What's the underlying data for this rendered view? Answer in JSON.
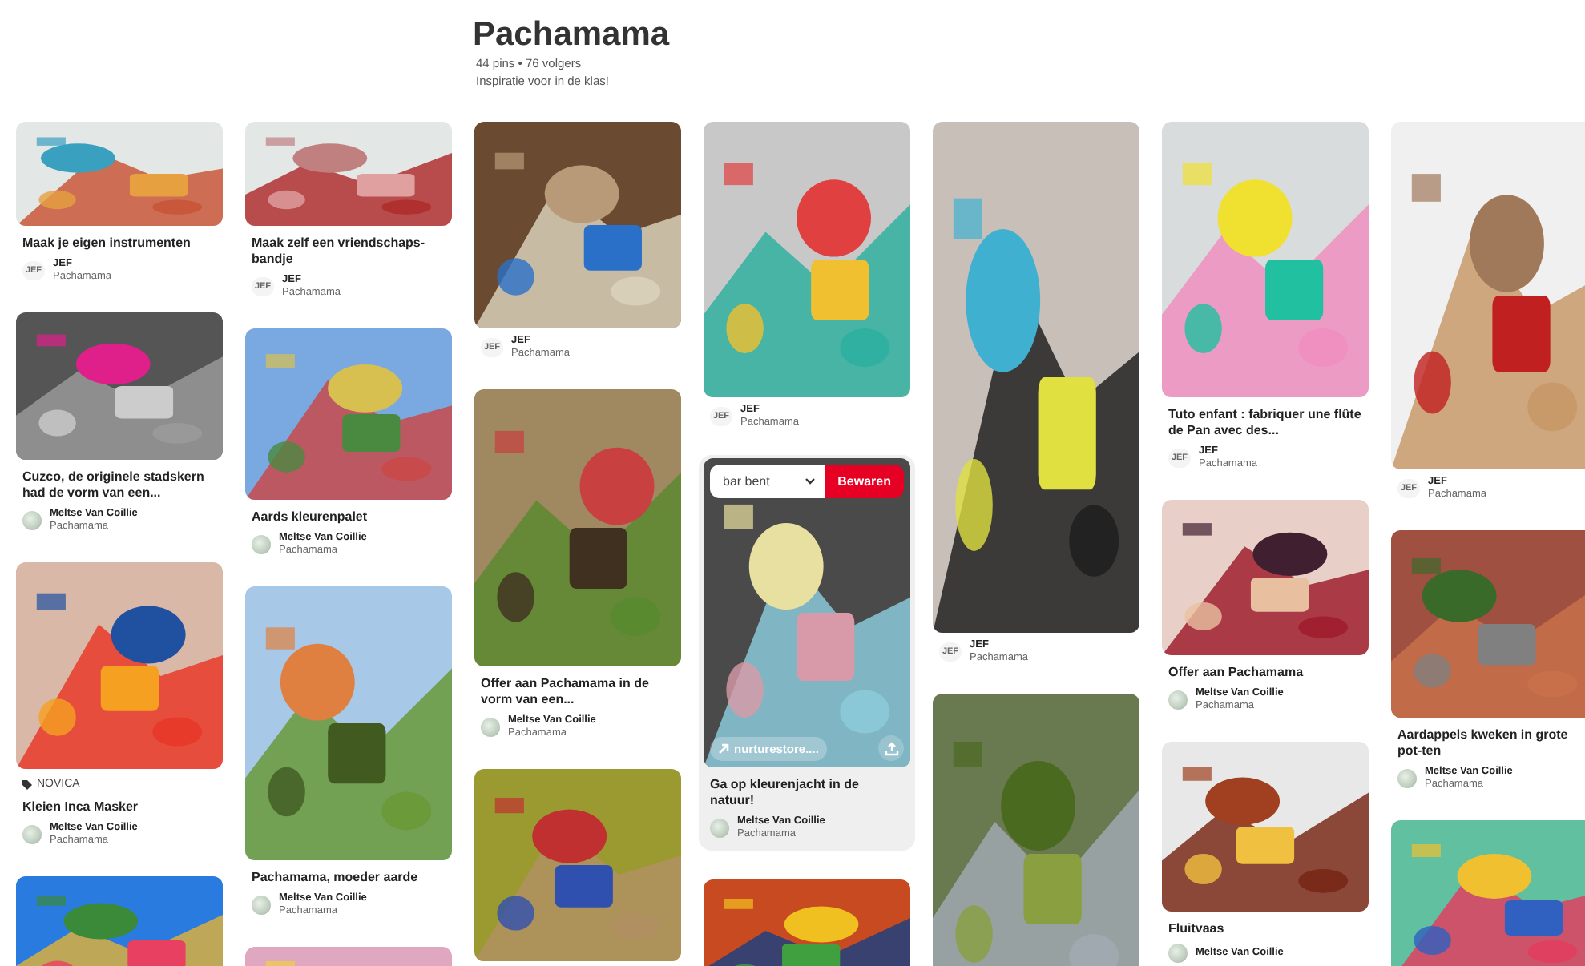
{
  "board": {
    "title": "Pachamama",
    "stats": "44 pins • 76 volgers",
    "description": "Inspiratie voor in de klas!"
  },
  "columns": [
    {
      "pins": [
        {
          "title": "Maak je eigen instrumenten",
          "author": {
            "name": "JEF",
            "board": "Pachamama",
            "avatar": {
              "kind": "initials",
              "text": "JEF"
            }
          },
          "hovered": false
        },
        {
          "title": "Cuzco, de originele stadskern had de vorm van een...",
          "author": {
            "name": "Meltse Van Coillie",
            "board": "Pachamama"
          },
          "hovered": false
        },
        {
          "source": "NOVICA",
          "title": "Kleien Inca Masker",
          "author": {
            "name": "Meltse Van Coillie",
            "board": "Pachamama"
          },
          "hovered": false
        },
        {
          "hovered": false
        }
      ]
    },
    {
      "pins": [
        {
          "title": "Maak zelf een vriendschaps-bandje",
          "author": {
            "name": "JEF",
            "board": "Pachamama",
            "avatar": {
              "kind": "initials",
              "text": "JEF"
            }
          },
          "hovered": false
        },
        {
          "title": "Aards kleurenpalet",
          "author": {
            "name": "Meltse Van Coillie",
            "board": "Pachamama"
          },
          "hovered": false
        },
        {
          "title": "Pachamama, moeder aarde",
          "author": {
            "name": "Meltse Van Coillie",
            "board": "Pachamama"
          },
          "hovered": false
        },
        {
          "hovered": false
        }
      ]
    },
    {
      "pins": [
        {
          "author": {
            "name": "JEF",
            "board": "Pachamama",
            "avatar": {
              "kind": "initials",
              "text": "JEF"
            }
          },
          "hovered": false
        },
        {
          "title": "Offer aan Pachamama in de vorm van een...",
          "author": {
            "name": "Meltse Van Coillie",
            "board": "Pachamama"
          },
          "hovered": false
        },
        {
          "hovered": false
        }
      ]
    },
    {
      "pins": [
        {
          "author": {
            "name": "JEF",
            "board": "Pachamama",
            "avatar": {
              "kind": "initials",
              "text": "JEF"
            }
          },
          "hovered": false
        },
        {
          "title": "Ga op kleurenjacht in de natuur!",
          "author": {
            "name": "Meltse Van Coillie",
            "board": "Pachamama"
          },
          "hovered": true,
          "overlay": {
            "board_select": "bar bent",
            "save": "Bewaren",
            "link": "nurturestore...."
          }
        },
        {
          "hovered": false
        }
      ]
    },
    {
      "pins": [
        {
          "author": {
            "name": "JEF",
            "board": "Pachamama",
            "avatar": {
              "kind": "initials",
              "text": "JEF"
            }
          },
          "hovered": false
        },
        {
          "hovered": false
        }
      ]
    },
    {
      "pins": [
        {
          "title": "Tuto enfant : fabriquer une flûte de Pan avec des...",
          "author": {
            "name": "JEF",
            "board": "Pachamama",
            "avatar": {
              "kind": "initials",
              "text": "JEF"
            }
          },
          "hovered": false
        },
        {
          "title": "Offer aan Pachamama",
          "author": {
            "name": "Meltse Van Coillie",
            "board": "Pachamama"
          },
          "hovered": false
        },
        {
          "title": "Fluitvaas",
          "author": {
            "name": "Meltse Van Coillie"
          },
          "hovered": false
        }
      ]
    },
    {
      "pins": [
        {
          "author": {
            "name": "JEF",
            "board": "Pachamama",
            "avatar": {
              "kind": "initials",
              "text": "JEF"
            }
          },
          "hovered": false
        },
        {
          "title": "Aardappels kweken in grote pot-ten",
          "author": {
            "name": "Meltse Van Coillie",
            "board": "Pachamama"
          },
          "hovered": false
        },
        {
          "hovered": false
        }
      ]
    }
  ]
}
